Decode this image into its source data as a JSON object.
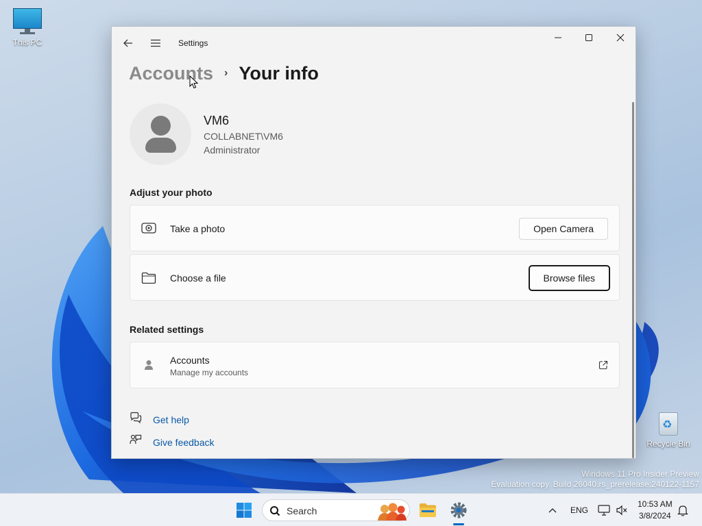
{
  "desktop": {
    "this_pc_label": "This PC",
    "recycle_bin_label": "Recycle Bin",
    "watermark_line1": "Windows 11 Pro Insider Preview",
    "watermark_line2": "Evaluation copy. Build 26040.rs_prerelease.240122-1157"
  },
  "window": {
    "app_title": "Settings",
    "breadcrumb_parent": "Accounts",
    "breadcrumb_separator": "›",
    "breadcrumb_current": "Your info"
  },
  "profile": {
    "name": "VM6",
    "domain_account": "COLLABNET\\VM6",
    "role": "Administrator"
  },
  "adjust_photo": {
    "heading": "Adjust your photo",
    "take_photo_label": "Take a photo",
    "open_camera_button": "Open Camera",
    "choose_file_label": "Choose a file",
    "browse_files_button": "Browse files"
  },
  "related_settings": {
    "heading": "Related settings",
    "accounts_title": "Accounts",
    "accounts_subtitle": "Manage my accounts"
  },
  "help_links": {
    "get_help": "Get help",
    "give_feedback": "Give feedback"
  },
  "taskbar": {
    "search_placeholder": "Search",
    "language": "ENG",
    "time": "10:53 AM",
    "date": "3/8/2024"
  },
  "colors": {
    "link": "#0a5aa6",
    "accent": "#0067c0"
  }
}
